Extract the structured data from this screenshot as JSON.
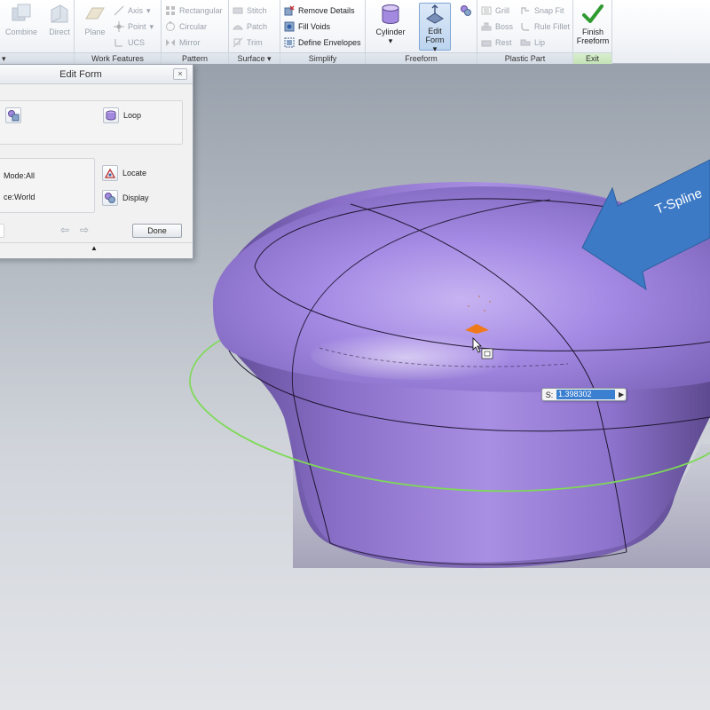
{
  "ribbon": {
    "combine": {
      "label": "Combine"
    },
    "direct": {
      "label": "Direct"
    },
    "plane": {
      "label": "Plane"
    },
    "axis": {
      "label": "Axis"
    },
    "point": {
      "label": "Point"
    },
    "ucs": {
      "label": "UCS"
    },
    "rectangular": {
      "label": "Rectangular"
    },
    "circular": {
      "label": "Circular"
    },
    "mirror": {
      "label": "Mirror"
    },
    "stitch": {
      "label": "Stitch"
    },
    "patch": {
      "label": "Patch"
    },
    "trim": {
      "label": "Trim"
    },
    "remove_details": {
      "label": "Remove Details"
    },
    "fill_voids": {
      "label": "Fill Voids"
    },
    "define_envelopes": {
      "label": "Define Envelopes"
    },
    "cylinder": {
      "label": "Cylinder"
    },
    "edit_form": {
      "line1": "Edit",
      "line2": "Form"
    },
    "grill": {
      "label": "Grill"
    },
    "boss": {
      "label": "Boss"
    },
    "rest": {
      "label": "Rest"
    },
    "snap_fit": {
      "label": "Snap Fit"
    },
    "rule_fillet": {
      "label": "Rule Fillet"
    },
    "lip": {
      "label": "Lip"
    },
    "finish_freeform": {
      "line1": "Finish",
      "line2": "Freeform"
    },
    "panels": {
      "work_features": "Work Features",
      "pattern": "Pattern",
      "surface": "Surface",
      "simplify": "Simplify",
      "freeform": "Freeform",
      "plastic_part": "Plastic Part",
      "exit": "Exit"
    },
    "colors": {
      "accent": "#3b7fd1",
      "finish_check": "#2f9a2f"
    }
  },
  "dialog": {
    "title": "Edit Form",
    "close_label": "×",
    "loop_label": "Loop",
    "mode_label": "Mode:All",
    "space_label": "ce:World",
    "locate_label": "Locate",
    "display_label": "Display",
    "undo_label": "⇦",
    "redo_label": "⇨",
    "done_label": "Done",
    "expander_label": "▲"
  },
  "viewport": {
    "callout_text": "T-Spline",
    "value_label": "S:",
    "value": "1.398302",
    "stepper_icon": "▶",
    "colors": {
      "shape": "#9a7fd6",
      "ring": "#7ed957",
      "callout": "#3d7ac6",
      "handle": "#f07a1a"
    }
  }
}
